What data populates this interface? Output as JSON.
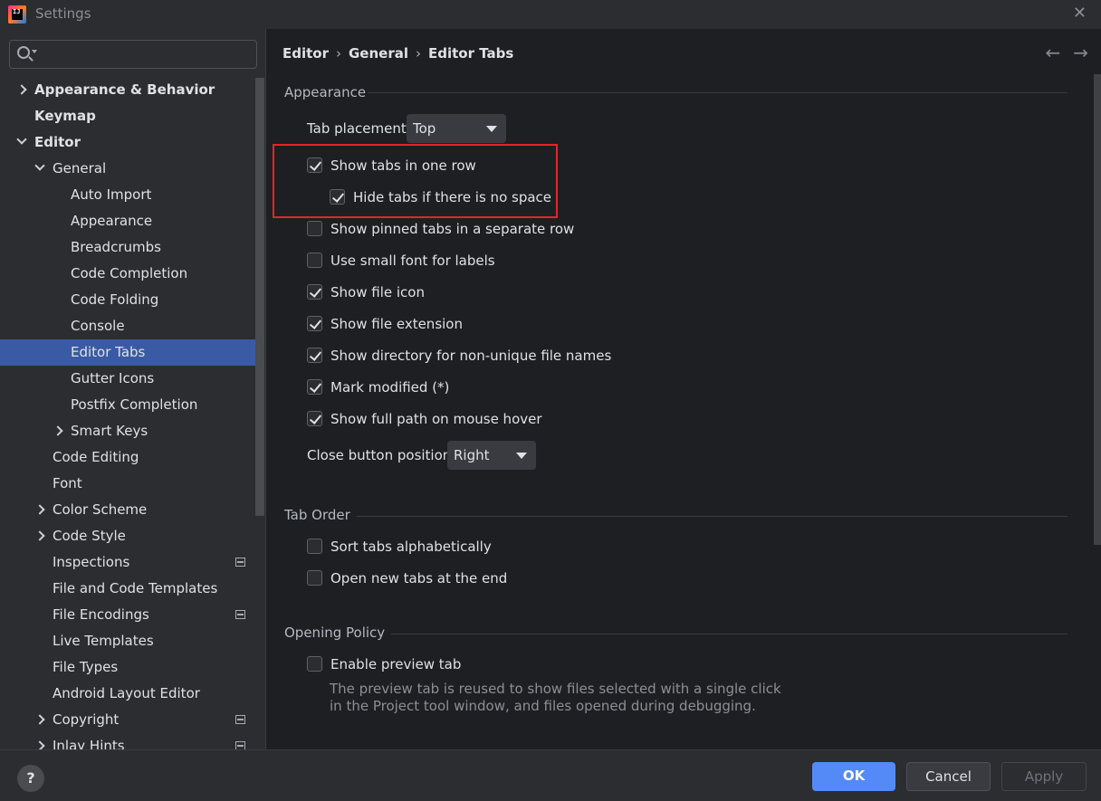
{
  "window": {
    "title": "Settings",
    "app_logo_text": "IJ",
    "close_glyph": "✕"
  },
  "sidebar": {
    "search_placeholder": "",
    "items": [
      {
        "label": "Appearance & Behavior",
        "level": 0,
        "bold": true,
        "chevron": "right"
      },
      {
        "label": "Keymap",
        "level": 0,
        "bold": true,
        "chevron": ""
      },
      {
        "label": "Editor",
        "level": 0,
        "bold": true,
        "chevron": "down"
      },
      {
        "label": "General",
        "level": 1,
        "bold": false,
        "chevron": "down"
      },
      {
        "label": "Auto Import",
        "level": 2,
        "bold": false,
        "chevron": ""
      },
      {
        "label": "Appearance",
        "level": 2,
        "bold": false,
        "chevron": ""
      },
      {
        "label": "Breadcrumbs",
        "level": 2,
        "bold": false,
        "chevron": ""
      },
      {
        "label": "Code Completion",
        "level": 2,
        "bold": false,
        "chevron": ""
      },
      {
        "label": "Code Folding",
        "level": 2,
        "bold": false,
        "chevron": ""
      },
      {
        "label": "Console",
        "level": 2,
        "bold": false,
        "chevron": ""
      },
      {
        "label": "Editor Tabs",
        "level": 2,
        "bold": false,
        "chevron": "",
        "selected": true
      },
      {
        "label": "Gutter Icons",
        "level": 2,
        "bold": false,
        "chevron": ""
      },
      {
        "label": "Postfix Completion",
        "level": 2,
        "bold": false,
        "chevron": ""
      },
      {
        "label": "Smart Keys",
        "level": 2,
        "bold": false,
        "chevron": "right"
      },
      {
        "label": "Code Editing",
        "level": 1,
        "bold": false,
        "chevron": ""
      },
      {
        "label": "Font",
        "level": 1,
        "bold": false,
        "chevron": ""
      },
      {
        "label": "Color Scheme",
        "level": 1,
        "bold": false,
        "chevron": "right"
      },
      {
        "label": "Code Style",
        "level": 1,
        "bold": false,
        "chevron": "right"
      },
      {
        "label": "Inspections",
        "level": 1,
        "bold": false,
        "chevron": "",
        "project_icon": true
      },
      {
        "label": "File and Code Templates",
        "level": 1,
        "bold": false,
        "chevron": ""
      },
      {
        "label": "File Encodings",
        "level": 1,
        "bold": false,
        "chevron": "",
        "project_icon": true
      },
      {
        "label": "Live Templates",
        "level": 1,
        "bold": false,
        "chevron": ""
      },
      {
        "label": "File Types",
        "level": 1,
        "bold": false,
        "chevron": ""
      },
      {
        "label": "Android Layout Editor",
        "level": 1,
        "bold": false,
        "chevron": ""
      },
      {
        "label": "Copyright",
        "level": 1,
        "bold": false,
        "chevron": "right",
        "project_icon": true
      },
      {
        "label": "Inlay Hints",
        "level": 1,
        "bold": false,
        "chevron": "right",
        "project_icon": true
      }
    ]
  },
  "breadcrumb": {
    "parts": [
      "Editor",
      "General",
      "Editor Tabs"
    ],
    "separator": "›"
  },
  "nav": {
    "back": "←",
    "forward": "→"
  },
  "appearance": {
    "title": "Appearance",
    "tab_placement_label": "Tab placement:",
    "tab_placement_value": "Top",
    "options": [
      {
        "label": "Show tabs in one row",
        "checked": true
      },
      {
        "label": "Hide tabs if there is no space",
        "checked": true
      },
      {
        "label": "Show pinned tabs in a separate row",
        "checked": false
      },
      {
        "label": "Use small font for labels",
        "checked": false
      },
      {
        "label": "Show file icon",
        "checked": true
      },
      {
        "label": "Show file extension",
        "checked": true
      },
      {
        "label": "Show directory for non-unique file names",
        "checked": true
      },
      {
        "label": "Mark modified (*)",
        "checked": true
      },
      {
        "label": "Show full path on mouse hover",
        "checked": true
      }
    ],
    "close_button_label": "Close button position:",
    "close_button_value": "Right"
  },
  "tab_order": {
    "title": "Tab Order",
    "options": [
      {
        "label": "Sort tabs alphabetically",
        "checked": false
      },
      {
        "label": "Open new tabs at the end",
        "checked": false
      }
    ]
  },
  "opening_policy": {
    "title": "Opening Policy",
    "options": [
      {
        "label": "Enable preview tab",
        "checked": false
      }
    ],
    "description_line1": "The preview tab is reused to show files selected with a single click",
    "description_line2": "in the Project tool window, and files opened during debugging."
  },
  "footer": {
    "help": "?",
    "ok": "OK",
    "cancel": "Cancel",
    "apply": "Apply"
  },
  "colors": {
    "accent": "#548af7",
    "selection": "#3a5ba3",
    "highlight_box": "#e5242a"
  }
}
